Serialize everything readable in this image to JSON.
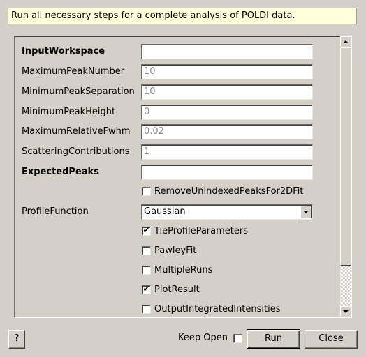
{
  "description": "Run all necessary steps for a complete analysis of POLDI data.",
  "properties": [
    {
      "label": "InputWorkspace",
      "value": "",
      "bold": true
    },
    {
      "label": "MaximumPeakNumber",
      "value": "10"
    },
    {
      "label": "MinimumPeakSeparation",
      "value": "10"
    },
    {
      "label": "MinimumPeakHeight",
      "value": "0"
    },
    {
      "label": "MaximumRelativeFwhm",
      "value": "0.02"
    },
    {
      "label": "ScatteringContributions",
      "value": "1"
    },
    {
      "label": "ExpectedPeaks",
      "value": "",
      "bold": true
    }
  ],
  "remove_unindexed": {
    "label": "RemoveUnindexedPeaksFor2DFit",
    "checked": false
  },
  "profile_function": {
    "label": "ProfileFunction",
    "selected": "Gaussian"
  },
  "checkboxes": [
    {
      "label": "TieProfileParameters",
      "checked": true
    },
    {
      "label": "PawleyFit",
      "checked": false
    },
    {
      "label": "MultipleRuns",
      "checked": false
    },
    {
      "label": "PlotResult",
      "checked": true
    },
    {
      "label": "OutputIntegratedIntensities",
      "checked": false
    }
  ],
  "footer": {
    "help_label": "?",
    "keep_open_label": "Keep Open",
    "keep_open_checked": false,
    "run_label": "Run",
    "close_label": "Close"
  },
  "check_mark": "✔"
}
